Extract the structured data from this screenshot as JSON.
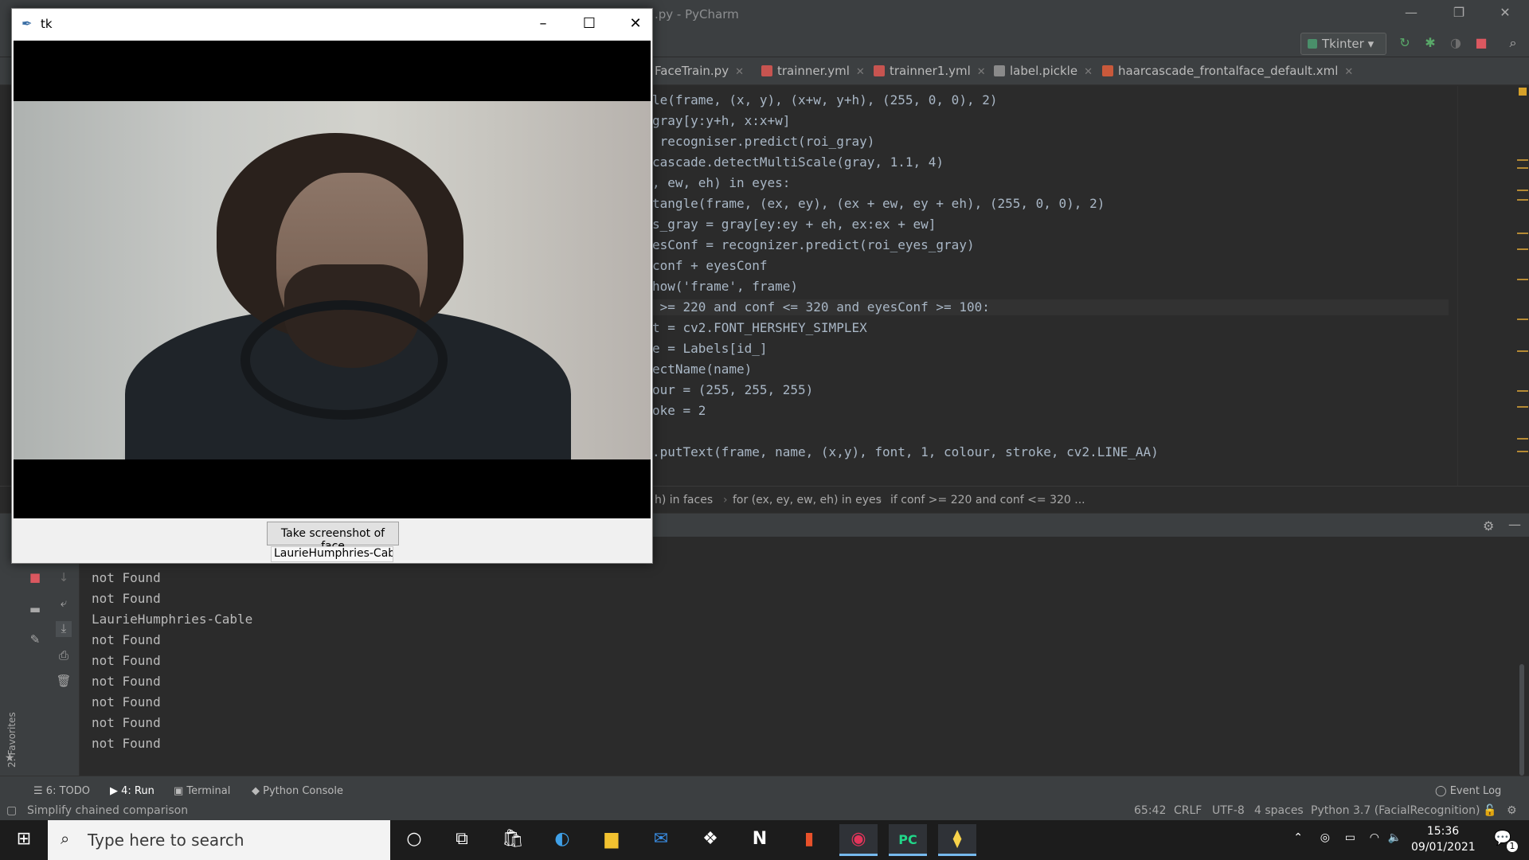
{
  "pycharm": {
    "title": ".py - PyCharm",
    "run_config": "Tkinter",
    "tabs": [
      "FaceTrain.py",
      "trainner.yml",
      "trainner1.yml",
      "label.pickle",
      "haarcascade_frontalface_default.xml"
    ],
    "code_lines": [
      "le(frame, (x, y), (x+w, y+h), (255, 0, 0), 2)",
      "gray[y:y+h, x:x+w]",
      " recogniser.predict(roi_gray)",
      "cascade.detectMultiScale(gray, 1.1, 4)",
      ", ew, eh) in eyes:",
      "tangle(frame, (ex, ey), (ex + ew, ey + eh), (255, 0, 0), 2)",
      "s_gray = gray[ey:ey + eh, ex:ex + ew]",
      "esConf = recognizer.predict(roi_eyes_gray)",
      "conf + eyesConf",
      "how('frame', frame)",
      " >= 220 and conf <= 320 and eyesConf >= 100:",
      "t = cv2.FONT_HERSHEY_SIMPLEX",
      "e = Labels[id_]",
      "ectName(name)",
      "our = (255, 255, 255)",
      "oke = 2",
      "",
      ".putText(frame, name, (x,y), font, 1, colour, stroke, cv2.LINE_AA)"
    ],
    "breadcrumbs": [
      "h) in faces",
      "for (ex, ey, ew, eh) in eyes",
      "if conf >= 220 and conf <= 320 ..."
    ],
    "console_lines": [
      "not Found",
      "not Found",
      "LaurieHumphries-Cable",
      "not Found",
      "not Found",
      "not Found",
      "not Found",
      "not Found",
      "not Found"
    ],
    "bottom_tabs": {
      "todo": "6: TODO",
      "run": "4: Run",
      "terminal": "Terminal",
      "python_console": "Python Console",
      "event_log": "Event Log"
    },
    "favorites_label": "2: Favorites",
    "status": {
      "message": "Simplify chained comparison",
      "position": "65:42",
      "line_sep": "CRLF",
      "encoding": "UTF-8",
      "indent": "4 spaces",
      "interpreter": "Python 3.7 (FacialRecognition)"
    }
  },
  "tk": {
    "title": "tk",
    "button_label": "Take screenshot of face",
    "name_label": "LaurieHumphries-Cabl"
  },
  "taskbar": {
    "search_placeholder": "Type here to search",
    "time": "15:36",
    "date": "09/01/2021",
    "notification_count": "1"
  },
  "colors": {
    "accent": "#76b9ed",
    "keyword": "#cc7832",
    "number": "#6897bb",
    "string": "#6a8759"
  }
}
